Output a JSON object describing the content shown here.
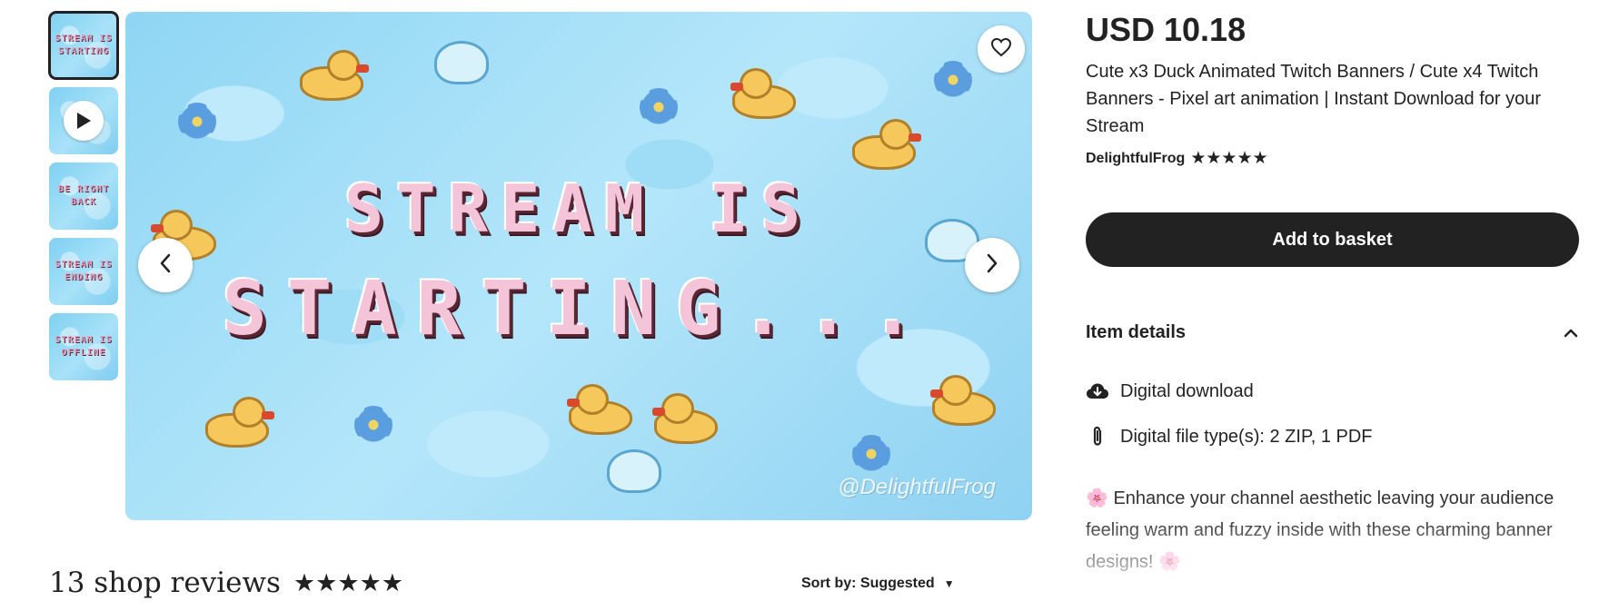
{
  "gallery": {
    "thumbnails": [
      {
        "line1": "STREAM IS",
        "line2": "STARTING"
      },
      {
        "video": true
      },
      {
        "line1": "BE RIGHT",
        "line2": "BACK"
      },
      {
        "line1": "STREAM IS",
        "line2": "ENDING"
      },
      {
        "line1": "STREAM IS",
        "line2": "OFFLINE"
      }
    ],
    "banner_line1": "STREAM IS",
    "banner_line2": "STARTING...",
    "watermark": "@DelightfulFrog"
  },
  "reviews": {
    "title": "13 shop reviews",
    "rating": 5,
    "sort_label": "Sort by: Suggested",
    "sort_caret": "▼"
  },
  "listing": {
    "price": "USD 10.18",
    "title": "Cute x3 Duck Animated Twitch Banners / Cute x4 Twitch Banners - Pixel art animation | Instant Download for your Stream",
    "shop_name": "DelightfulFrog",
    "shop_rating": 5,
    "add_to_basket": "Add to basket",
    "item_details_title": "Item details",
    "details": [
      {
        "icon": "cloud-download-icon",
        "text": "Digital download"
      },
      {
        "icon": "paperclip-icon",
        "text": "Digital file type(s): 2 ZIP, 1 PDF"
      }
    ],
    "description": "🌸 Enhance your channel aesthetic leaving your audience feeling warm and fuzzy inside with these charming banner designs! 🌸"
  },
  "colors": {
    "button_dark": "#222222",
    "water_blue": "#8fd6f4",
    "duck_yellow": "#f6c75a",
    "banner_pink": "#f4c4d8"
  }
}
